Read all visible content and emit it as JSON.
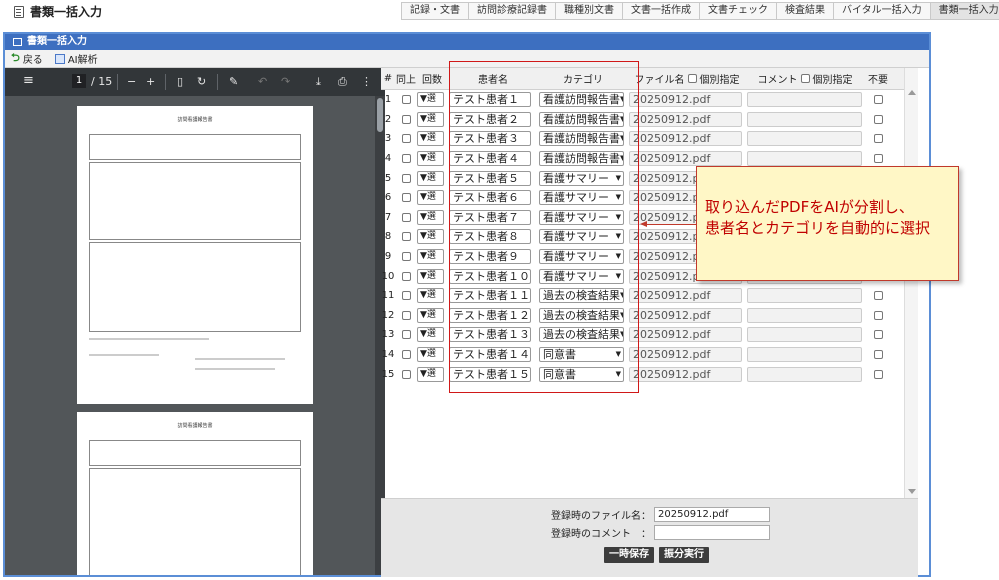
{
  "header": {
    "title": "書類一括入力",
    "tabs": [
      "記録・文書",
      "訪問診療記録書",
      "職種別文書",
      "文書一括作成",
      "文書チェック",
      "検査結果",
      "バイタル一括入力",
      "書類一括入力"
    ],
    "active_tab": "書類一括入力"
  },
  "window": {
    "title": "書類一括入力",
    "back_label": "戻る",
    "ai_label": "AI解析"
  },
  "pdf_viewer": {
    "current_page": "1",
    "total_pages": "/ 15",
    "page1_title": "訪問看護報告書",
    "page2_title": "訪問看護報告書"
  },
  "grid": {
    "headers": {
      "num": "#",
      "record": "同上",
      "kai": "回数",
      "patient": "患者名",
      "category": "カテゴリ",
      "file": "ファイル名",
      "file_flag": "個別指定",
      "comment": "コメント",
      "comment_flag": "個別指定",
      "delete": "不要"
    },
    "kai_value": "▼選",
    "rows": [
      {
        "num": "1",
        "patient": "テスト患者１",
        "category": "看護訪問報告書",
        "file": "20250912.pdf"
      },
      {
        "num": "2",
        "patient": "テスト患者２",
        "category": "看護訪問報告書",
        "file": "20250912.pdf"
      },
      {
        "num": "3",
        "patient": "テスト患者３",
        "category": "看護訪問報告書",
        "file": "20250912.pdf"
      },
      {
        "num": "4",
        "patient": "テスト患者４",
        "category": "看護訪問報告書",
        "file": "20250912.pdf"
      },
      {
        "num": "5",
        "patient": "テスト患者５",
        "category": "看護サマリー",
        "file": "20250912.pdf"
      },
      {
        "num": "6",
        "patient": "テスト患者６",
        "category": "看護サマリー",
        "file": "20250912.pdf"
      },
      {
        "num": "7",
        "patient": "テスト患者７",
        "category": "看護サマリー",
        "file": "20250912.pdf"
      },
      {
        "num": "8",
        "patient": "テスト患者８",
        "category": "看護サマリー",
        "file": "20250912.pdf"
      },
      {
        "num": "9",
        "patient": "テスト患者９",
        "category": "看護サマリー",
        "file": "20250912.pdf"
      },
      {
        "num": "10",
        "patient": "テスト患者１０",
        "category": "看護サマリー",
        "file": "20250912.pdf"
      },
      {
        "num": "11",
        "patient": "テスト患者１１",
        "category": "過去の検査結果",
        "file": "20250912.pdf"
      },
      {
        "num": "12",
        "patient": "テスト患者１２",
        "category": "過去の検査結果",
        "file": "20250912.pdf"
      },
      {
        "num": "13",
        "patient": "テスト患者１３",
        "category": "過去の検査結果",
        "file": "20250912.pdf"
      },
      {
        "num": "14",
        "patient": "テスト患者１４",
        "category": "同意書",
        "file": "20250912.pdf"
      },
      {
        "num": "15",
        "patient": "テスト患者１５",
        "category": "同意書",
        "file": "20250912.pdf"
      }
    ]
  },
  "callout": {
    "line1": "取り込んだPDFをAIが分割し、",
    "line2": "患者名とカテゴリを自動的に選択"
  },
  "form": {
    "file_label": "登録時のファイル名：",
    "file_value": "20250912.pdf",
    "comment_label": "登録時のコメント　：",
    "comment_value": "",
    "save_label": "一時保存",
    "run_label": "振分実行"
  },
  "colors": {
    "accent": "#3d6fc0",
    "highlight": "#d01818",
    "callout_bg": "#fff7c6",
    "callout_text": "#c00000"
  }
}
